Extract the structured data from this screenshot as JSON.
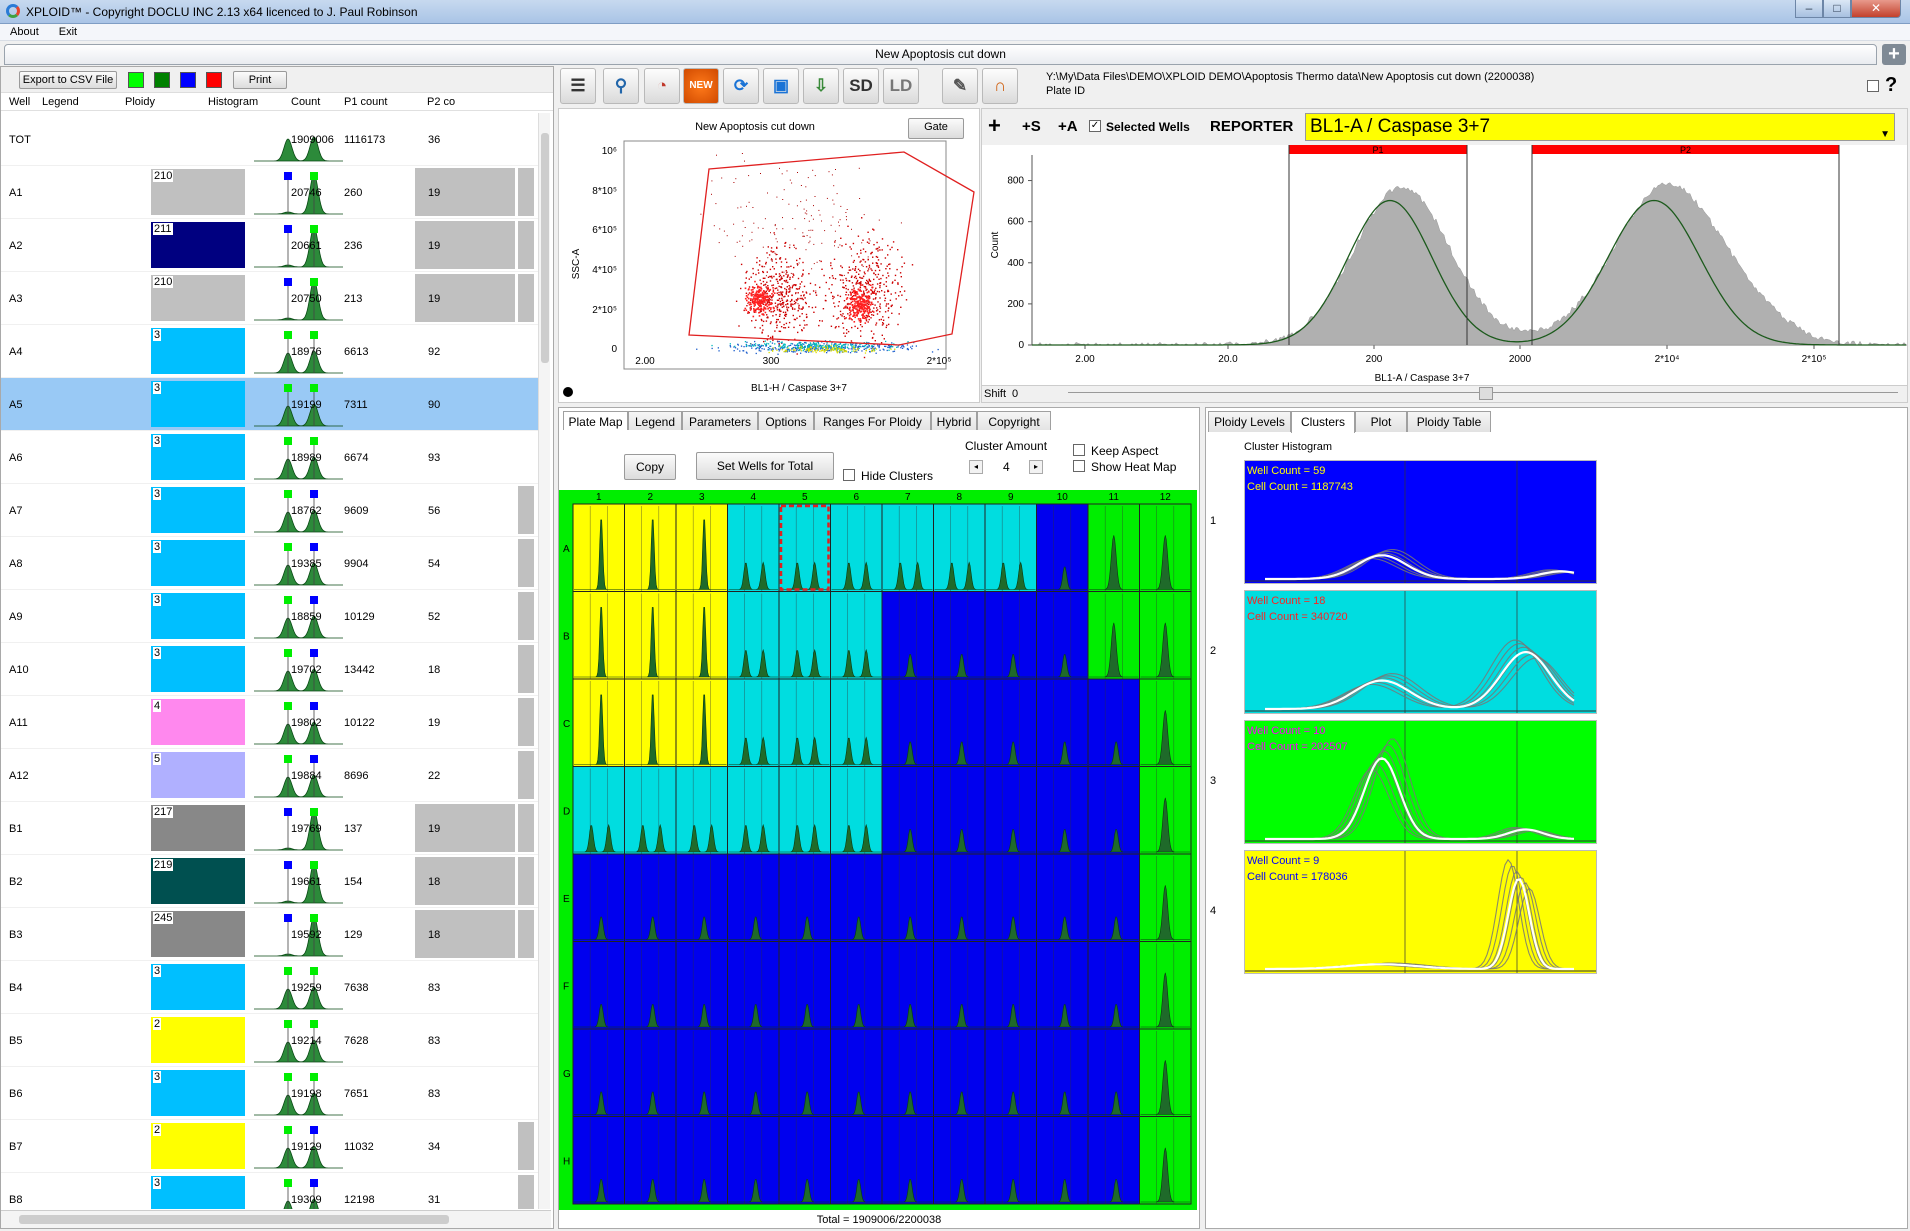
{
  "window": {
    "title": "XPLOID™ - Copyright DOCLU INC 2.13 x64 licenced to J. Paul Robinson",
    "minimize": "–",
    "maximize": "□",
    "close": "✕"
  },
  "menu": [
    "About",
    "Exit"
  ],
  "doc_tab": {
    "title": "New Apoptosis cut down",
    "add": "+"
  },
  "left": {
    "export_label": "Export to CSV File",
    "print_label": "Print",
    "swatches": [
      "#00ff00",
      "#008000",
      "#0000ff",
      "#ff0000"
    ],
    "columns": [
      "Well",
      "Legend",
      "Ploidy",
      "Histogram",
      "Count",
      "P1 count",
      "P2 co"
    ],
    "rows": [
      {
        "well": "TOT",
        "ploidy": "",
        "color": "",
        "count": "1909006",
        "p1": "1116173",
        "p2": "36",
        "p1gray": false,
        "p2gray": false
      },
      {
        "well": "A1",
        "ploidy": "210",
        "color": "#c0c0c0",
        "count": "20746",
        "p1": "260",
        "p2": "19",
        "p1gray": true,
        "p2gray": true
      },
      {
        "well": "A2",
        "ploidy": "211",
        "color": "#000080",
        "count": "20661",
        "p1": "236",
        "p2": "19",
        "p1gray": true,
        "p2gray": true
      },
      {
        "well": "A3",
        "ploidy": "210",
        "color": "#c0c0c0",
        "count": "20750",
        "p1": "213",
        "p2": "19",
        "p1gray": true,
        "p2gray": true
      },
      {
        "well": "A4",
        "ploidy": "3",
        "color": "#00bfff",
        "count": "18976",
        "p1": "6613",
        "p2": "92",
        "p1gray": false,
        "p2gray": false
      },
      {
        "well": "A5",
        "ploidy": "3",
        "color": "#00bfff",
        "count": "19199",
        "p1": "7311",
        "p2": "90",
        "p1gray": false,
        "p2gray": false
      },
      {
        "well": "A6",
        "ploidy": "3",
        "color": "#00bfff",
        "count": "18989",
        "p1": "6674",
        "p2": "93",
        "p1gray": false,
        "p2gray": false
      },
      {
        "well": "A7",
        "ploidy": "3",
        "color": "#00bfff",
        "count": "18762",
        "p1": "9609",
        "p2": "56",
        "p1gray": false,
        "p2gray": true
      },
      {
        "well": "A8",
        "ploidy": "3",
        "color": "#00bfff",
        "count": "19385",
        "p1": "9904",
        "p2": "54",
        "p1gray": false,
        "p2gray": true
      },
      {
        "well": "A9",
        "ploidy": "3",
        "color": "#00bfff",
        "count": "18859",
        "p1": "10129",
        "p2": "52",
        "p1gray": false,
        "p2gray": true
      },
      {
        "well": "A10",
        "ploidy": "3",
        "color": "#00bfff",
        "count": "19702",
        "p1": "13442",
        "p2": "18",
        "p1gray": false,
        "p2gray": true
      },
      {
        "well": "A11",
        "ploidy": "4",
        "color": "#ff88ee",
        "count": "19802",
        "p1": "10122",
        "p2": "19",
        "p1gray": false,
        "p2gray": true
      },
      {
        "well": "A12",
        "ploidy": "5",
        "color": "#b0b0ff",
        "count": "19884",
        "p1": "8696",
        "p2": "22",
        "p1gray": false,
        "p2gray": true
      },
      {
        "well": "B1",
        "ploidy": "217",
        "color": "#888888",
        "count": "19769",
        "p1": "137",
        "p2": "19",
        "p1gray": true,
        "p2gray": true
      },
      {
        "well": "B2",
        "ploidy": "219",
        "color": "#005050",
        "count": "19661",
        "p1": "154",
        "p2": "18",
        "p1gray": true,
        "p2gray": true
      },
      {
        "well": "B3",
        "ploidy": "245",
        "color": "#888888",
        "count": "19592",
        "p1": "129",
        "p2": "18",
        "p1gray": true,
        "p2gray": true
      },
      {
        "well": "B4",
        "ploidy": "3",
        "color": "#00bfff",
        "count": "19259",
        "p1": "7638",
        "p2": "83",
        "p1gray": false,
        "p2gray": false
      },
      {
        "well": "B5",
        "ploidy": "2",
        "color": "#ffff00",
        "count": "19214",
        "p1": "7628",
        "p2": "83",
        "p1gray": false,
        "p2gray": false
      },
      {
        "well": "B6",
        "ploidy": "3",
        "color": "#00bfff",
        "count": "19198",
        "p1": "7651",
        "p2": "83",
        "p1gray": false,
        "p2gray": false
      },
      {
        "well": "B7",
        "ploidy": "2",
        "color": "#ffff00",
        "count": "19129",
        "p1": "11032",
        "p2": "34",
        "p1gray": false,
        "p2gray": true
      },
      {
        "well": "B8",
        "ploidy": "3",
        "color": "#00bfff",
        "count": "19309",
        "p1": "12198",
        "p2": "31",
        "p1gray": false,
        "p2gray": true
      }
    ]
  },
  "toolbar": {
    "icons": [
      "ruler-icon",
      "keyhole-icon",
      "gauge-icon",
      "new-icon",
      "refresh-icon",
      "windows-icon",
      "download-icon",
      "sd-icon",
      "ld-icon",
      "pen-icon",
      "gate-icon"
    ],
    "sd": "SD",
    "ld": "LD",
    "file_path": "Y:\\My\\Data Files\\DEMO\\XPLOID DEMO\\Apoptosis Thermo data\\New Apoptosis cut down (2200038)",
    "plate_id_label": "Plate ID",
    "help": "?"
  },
  "scatter": {
    "title": "New Apoptosis cut down",
    "gate_label": "Gate",
    "ylabel": "SSC-A",
    "xlabel": "BL1-H / Caspase 3+7",
    "yticks": [
      "10⁶",
      "8*10⁵",
      "6*10⁵",
      "4*10⁵",
      "2*10⁵",
      "0"
    ],
    "xticks": [
      "2.00",
      "300",
      "2*10⁵"
    ]
  },
  "histogram": {
    "add": "+",
    "add_s": "+S",
    "add_a": "+A",
    "selected_wells": "Selected Wells",
    "reporter_label": "REPORTER",
    "reporter": "BL1-A / Caspase 3+7",
    "regions": [
      "P1",
      "P2"
    ],
    "ylabel": "Count",
    "xlabel": "BL1-A / Caspase 3+7",
    "yticks": [
      "800",
      "600",
      "400",
      "200",
      "0"
    ],
    "xticks": [
      "2.00",
      "20.0",
      "200",
      "2000",
      "2*10⁴",
      "2*10⁵"
    ],
    "shift_label": "Shift",
    "shift_value": "0"
  },
  "plate": {
    "tabs": [
      "Plate Map",
      "Legend",
      "Parameters",
      "Options",
      "Ranges For Ploidy",
      "Hybrid",
      "Copyright"
    ],
    "copy_label": "Copy",
    "set_wells_label": "Set Wells for Total",
    "hide_clusters": "Hide Clusters",
    "cluster_amount_label": "Cluster Amount",
    "cluster_amount": "4",
    "keep_aspect": "Keep Aspect",
    "show_heat_map": "Show Heat Map",
    "cols": [
      "1",
      "2",
      "3",
      "4",
      "5",
      "6",
      "7",
      "8",
      "9",
      "10",
      "11",
      "12"
    ],
    "rows": [
      "A",
      "B",
      "C",
      "D",
      "E",
      "F",
      "G",
      "H"
    ],
    "grid": [
      "YYYCCCCCCBGG",
      "YYYCCCBBBBGG",
      "YYYCCCBBBBBG",
      "CCCCCCBBBBBG",
      "BBBBBBBBBBBG",
      "BBBBBBBBBBBG",
      "BBBBBBBBBBBG",
      "BBBBBBBBBBBG"
    ],
    "total": "Total = 1909006/2200038"
  },
  "clusters": {
    "tabs": [
      "Ploidy Levels",
      "Clusters",
      "Plot",
      "Ploidy Table"
    ],
    "title": "Cluster Histogram",
    "items": [
      {
        "n": "1",
        "color": "#0000ff",
        "text_color": "#ffff00",
        "wells": "Well Count = 59",
        "cells": "Cell Count = 1187743"
      },
      {
        "n": "2",
        "color": "#00dde0",
        "text_color": "#ff2020",
        "wells": "Well Count = 18",
        "cells": "Cell Count = 340720"
      },
      {
        "n": "3",
        "color": "#00ff00",
        "text_color": "#ff00ff",
        "wells": "Well Count = 10",
        "cells": "Cell Count = 202507"
      },
      {
        "n": "4",
        "color": "#ffff00",
        "text_color": "#0000ff",
        "wells": "Well Count = 9",
        "cells": "Cell Count = 178036"
      }
    ]
  },
  "colors": {
    "Y": "#ffff00",
    "C": "#00dde0",
    "B": "#0000ee",
    "G": "#00ee00",
    "selected_row": "#99c9f5"
  }
}
